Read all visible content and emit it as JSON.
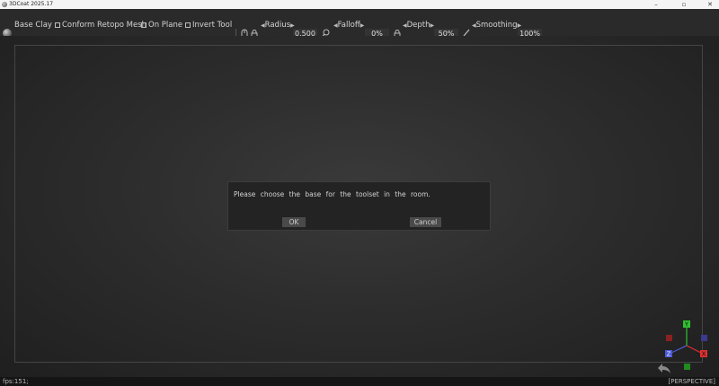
{
  "window": {
    "title": "3DCoat 2025.17",
    "icons": [
      "app-icon",
      "minimize-icon",
      "maximize-icon",
      "close-icon"
    ],
    "controls": {
      "minimize": "–",
      "maximize": "▫",
      "close": "✕"
    }
  },
  "toolbar": {
    "base_clay": "Base  Clay",
    "conform_retopo_mesh": "Conform  Retopo  Mesh",
    "on_plane": "On  Plane",
    "invert_tool": "Invert  Tool",
    "radius_label": "Radius",
    "radius_value": "0.500",
    "falloff_label": "Falloff",
    "falloff_value": "0%",
    "depth_label": "Depth",
    "depth_value": "50%",
    "smoothing_label": "Smoothing",
    "smoothing_value": "100%"
  },
  "dialog": {
    "message": "Please choose the base for the toolset in the room.",
    "ok_label": "OK",
    "cancel_label": "Cancel"
  },
  "gizmo": {
    "y": "Y",
    "z": "Z",
    "x": "X",
    "colors": {
      "x": "#e03030",
      "y": "#30c030",
      "z": "#4a5ad8",
      "neg_x": "#8a2020",
      "neg_y": "#208a20",
      "neg_z": "#3a3a90"
    }
  },
  "status": {
    "fps": "fps:151;",
    "projection": "[PERSPECTIVE]"
  }
}
